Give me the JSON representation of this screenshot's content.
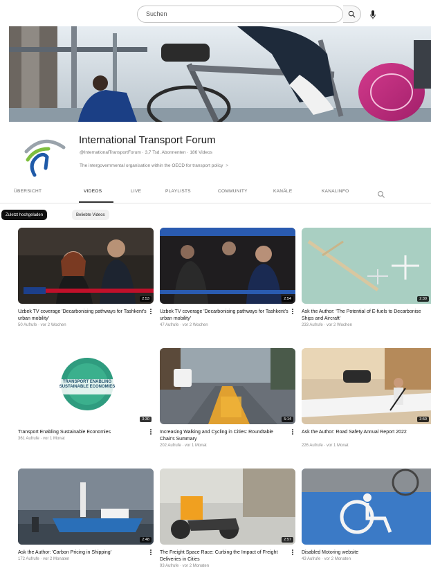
{
  "search": {
    "query": "Suchen"
  },
  "icons": {
    "search": "search-icon",
    "mic": "microphone-icon",
    "more": "more-vertical-icon"
  },
  "channel": {
    "name": "International Transport Forum",
    "meta": "@InternationalTransportForum · 3,7 Tsd. Abonnenten · 186 Videos",
    "description": "The intergovernmental organisation within the OECD for transport policy",
    "more_label": ">"
  },
  "tabs": [
    {
      "label": "ÜBERSICHT"
    },
    {
      "label": "VIDEOS"
    },
    {
      "label": "LIVE"
    },
    {
      "label": "PLAYLISTS"
    },
    {
      "label": "COMMUNITY"
    },
    {
      "label": "KANÄLE"
    },
    {
      "label": "KANALINFO"
    }
  ],
  "active_tab": "VIDEOS",
  "chips": [
    {
      "label": "Zuletzt hochgeladen"
    },
    {
      "label": "Beliebte Videos"
    }
  ],
  "videos": [
    {
      "title": "Uzbek TV coverage 'Decarbonising pathways for Tashkent's urban mobility'",
      "meta": "50 Aufrufe · vor 2 Wochen",
      "duration": "2:53"
    },
    {
      "title": "Uzbek TV coverage 'Decarbonising pathways for Tashkent's urban mobility'",
      "meta": "47 Aufrufe · vor 2 Wochen",
      "duration": "2:54"
    },
    {
      "title": "Ask the Author: 'The Potential of E-fuels to Decarbonise Ships and Aircraft'",
      "meta": "233 Aufrufe · vor 2 Wochen",
      "duration": "2:30"
    },
    {
      "title": "Transport Enabling Sustainable Economies",
      "meta": "361 Aufrufe · vor 1 Monat",
      "duration": "3:30"
    },
    {
      "title": "Increasing Walking and Cycling in Cities: Roundtable Chair's Summary",
      "meta": "202 Aufrufe · vor 1 Monat",
      "duration": "5:14"
    },
    {
      "title": "Ask the Author: Road Safety Annual Report 2022",
      "meta": "226 Aufrufe · vor 1 Monat",
      "duration": "3:50"
    },
    {
      "title": "Ask the Author: 'Carbon Pricing in Shipping'",
      "meta": "172 Aufrufe · vor 2 Monaten",
      "duration": "2:48"
    },
    {
      "title": "The Freight Space Race: Curbing the Impact of Freight Deliveries in Cities",
      "meta": "93 Aufrufe · vor 2 Monaten",
      "duration": "2:57"
    },
    {
      "title": "Disabled Motoring website",
      "meta": "43 Aufrufe · vor 2 Monaten",
      "duration": ""
    }
  ],
  "logo_text": "TRANSPORT ENABLING SUSTAINABLE ECONOMIES",
  "colors": {
    "accent_green": "#7fbf3f",
    "accent_blue": "#1f5aa8",
    "ship_blue": "#2a6fb8"
  }
}
